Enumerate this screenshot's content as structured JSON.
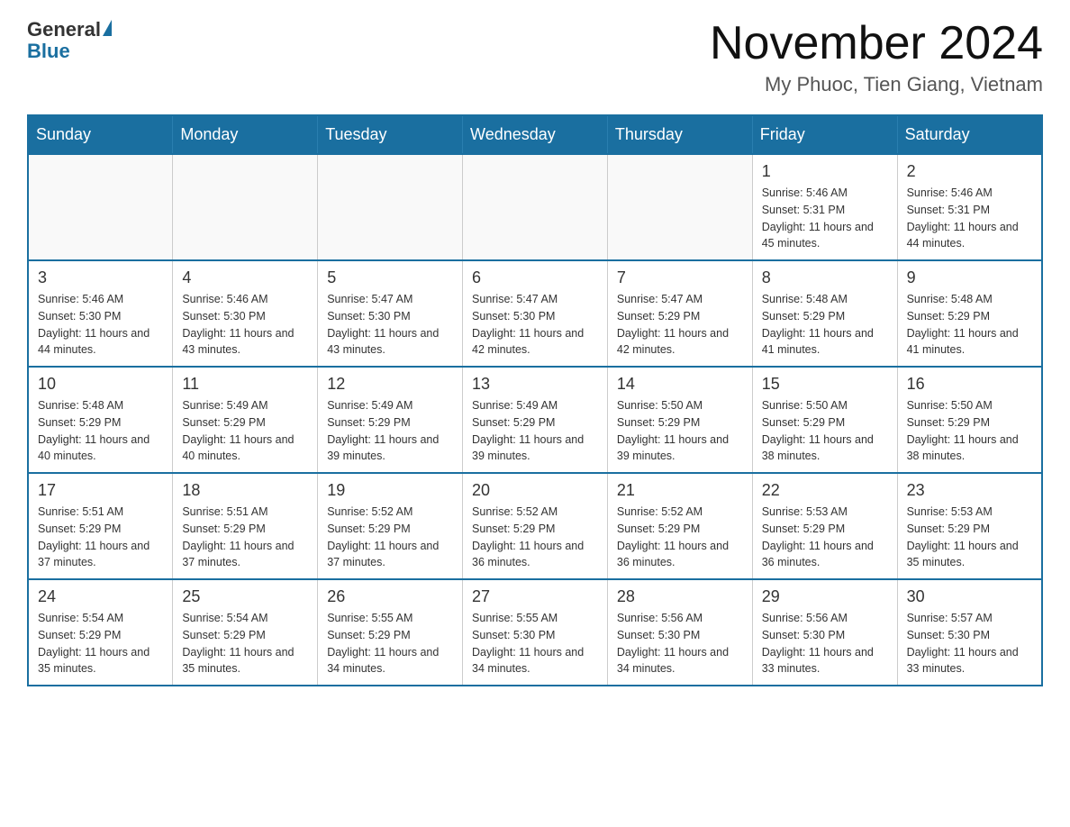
{
  "header": {
    "logo": {
      "general": "General",
      "blue": "Blue"
    },
    "title": "November 2024",
    "location": "My Phuoc, Tien Giang, Vietnam"
  },
  "days_of_week": [
    "Sunday",
    "Monday",
    "Tuesday",
    "Wednesday",
    "Thursday",
    "Friday",
    "Saturday"
  ],
  "weeks": [
    [
      {
        "day": "",
        "info": ""
      },
      {
        "day": "",
        "info": ""
      },
      {
        "day": "",
        "info": ""
      },
      {
        "day": "",
        "info": ""
      },
      {
        "day": "",
        "info": ""
      },
      {
        "day": "1",
        "info": "Sunrise: 5:46 AM\nSunset: 5:31 PM\nDaylight: 11 hours and 45 minutes."
      },
      {
        "day": "2",
        "info": "Sunrise: 5:46 AM\nSunset: 5:31 PM\nDaylight: 11 hours and 44 minutes."
      }
    ],
    [
      {
        "day": "3",
        "info": "Sunrise: 5:46 AM\nSunset: 5:30 PM\nDaylight: 11 hours and 44 minutes."
      },
      {
        "day": "4",
        "info": "Sunrise: 5:46 AM\nSunset: 5:30 PM\nDaylight: 11 hours and 43 minutes."
      },
      {
        "day": "5",
        "info": "Sunrise: 5:47 AM\nSunset: 5:30 PM\nDaylight: 11 hours and 43 minutes."
      },
      {
        "day": "6",
        "info": "Sunrise: 5:47 AM\nSunset: 5:30 PM\nDaylight: 11 hours and 42 minutes."
      },
      {
        "day": "7",
        "info": "Sunrise: 5:47 AM\nSunset: 5:29 PM\nDaylight: 11 hours and 42 minutes."
      },
      {
        "day": "8",
        "info": "Sunrise: 5:48 AM\nSunset: 5:29 PM\nDaylight: 11 hours and 41 minutes."
      },
      {
        "day": "9",
        "info": "Sunrise: 5:48 AM\nSunset: 5:29 PM\nDaylight: 11 hours and 41 minutes."
      }
    ],
    [
      {
        "day": "10",
        "info": "Sunrise: 5:48 AM\nSunset: 5:29 PM\nDaylight: 11 hours and 40 minutes."
      },
      {
        "day": "11",
        "info": "Sunrise: 5:49 AM\nSunset: 5:29 PM\nDaylight: 11 hours and 40 minutes."
      },
      {
        "day": "12",
        "info": "Sunrise: 5:49 AM\nSunset: 5:29 PM\nDaylight: 11 hours and 39 minutes."
      },
      {
        "day": "13",
        "info": "Sunrise: 5:49 AM\nSunset: 5:29 PM\nDaylight: 11 hours and 39 minutes."
      },
      {
        "day": "14",
        "info": "Sunrise: 5:50 AM\nSunset: 5:29 PM\nDaylight: 11 hours and 39 minutes."
      },
      {
        "day": "15",
        "info": "Sunrise: 5:50 AM\nSunset: 5:29 PM\nDaylight: 11 hours and 38 minutes."
      },
      {
        "day": "16",
        "info": "Sunrise: 5:50 AM\nSunset: 5:29 PM\nDaylight: 11 hours and 38 minutes."
      }
    ],
    [
      {
        "day": "17",
        "info": "Sunrise: 5:51 AM\nSunset: 5:29 PM\nDaylight: 11 hours and 37 minutes."
      },
      {
        "day": "18",
        "info": "Sunrise: 5:51 AM\nSunset: 5:29 PM\nDaylight: 11 hours and 37 minutes."
      },
      {
        "day": "19",
        "info": "Sunrise: 5:52 AM\nSunset: 5:29 PM\nDaylight: 11 hours and 37 minutes."
      },
      {
        "day": "20",
        "info": "Sunrise: 5:52 AM\nSunset: 5:29 PM\nDaylight: 11 hours and 36 minutes."
      },
      {
        "day": "21",
        "info": "Sunrise: 5:52 AM\nSunset: 5:29 PM\nDaylight: 11 hours and 36 minutes."
      },
      {
        "day": "22",
        "info": "Sunrise: 5:53 AM\nSunset: 5:29 PM\nDaylight: 11 hours and 36 minutes."
      },
      {
        "day": "23",
        "info": "Sunrise: 5:53 AM\nSunset: 5:29 PM\nDaylight: 11 hours and 35 minutes."
      }
    ],
    [
      {
        "day": "24",
        "info": "Sunrise: 5:54 AM\nSunset: 5:29 PM\nDaylight: 11 hours and 35 minutes."
      },
      {
        "day": "25",
        "info": "Sunrise: 5:54 AM\nSunset: 5:29 PM\nDaylight: 11 hours and 35 minutes."
      },
      {
        "day": "26",
        "info": "Sunrise: 5:55 AM\nSunset: 5:29 PM\nDaylight: 11 hours and 34 minutes."
      },
      {
        "day": "27",
        "info": "Sunrise: 5:55 AM\nSunset: 5:30 PM\nDaylight: 11 hours and 34 minutes."
      },
      {
        "day": "28",
        "info": "Sunrise: 5:56 AM\nSunset: 5:30 PM\nDaylight: 11 hours and 34 minutes."
      },
      {
        "day": "29",
        "info": "Sunrise: 5:56 AM\nSunset: 5:30 PM\nDaylight: 11 hours and 33 minutes."
      },
      {
        "day": "30",
        "info": "Sunrise: 5:57 AM\nSunset: 5:30 PM\nDaylight: 11 hours and 33 minutes."
      }
    ]
  ]
}
